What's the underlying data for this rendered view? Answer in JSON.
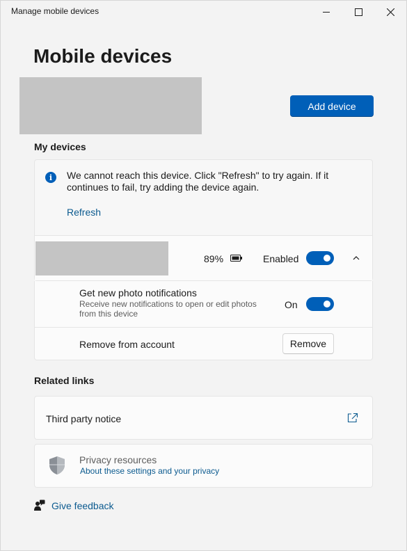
{
  "window": {
    "title": "Manage mobile devices",
    "controls": [
      "minimize-icon",
      "maximize-icon",
      "close-icon"
    ]
  },
  "page": {
    "title": "Mobile devices"
  },
  "actions": {
    "add_device_label": "Add device"
  },
  "my_devices": {
    "heading": "My devices",
    "alert": {
      "icon": "info-icon",
      "message": "We cannot reach this device. Click \"Refresh\" to try again. If it continues to fail, try adding the device again.",
      "refresh_label": "Refresh"
    },
    "device": {
      "battery_percent": "89%",
      "battery_icon": "battery-icon",
      "status_label": "Enabled",
      "enabled": true,
      "expander_icon": "chevron-up-icon"
    },
    "settings": {
      "photo_notifications": {
        "title": "Get new photo notifications",
        "description": "Receive new notifications to open or edit photos from this device",
        "state_label": "On",
        "on": true
      },
      "remove": {
        "label": "Remove from account",
        "button_label": "Remove"
      }
    }
  },
  "related_links": {
    "heading": "Related links",
    "third_party": {
      "label": "Third party notice",
      "icon": "open-external-icon"
    },
    "privacy": {
      "icon": "shield-icon",
      "title": "Privacy resources",
      "link": "About these settings and your privacy"
    }
  },
  "feedback": {
    "label": "Give feedback",
    "icon": "feedback-person-icon"
  },
  "colors": {
    "accent": "#005fb8",
    "link": "#0b5a8f",
    "background": "#f3f3f3",
    "card": "#fbfbfb"
  }
}
